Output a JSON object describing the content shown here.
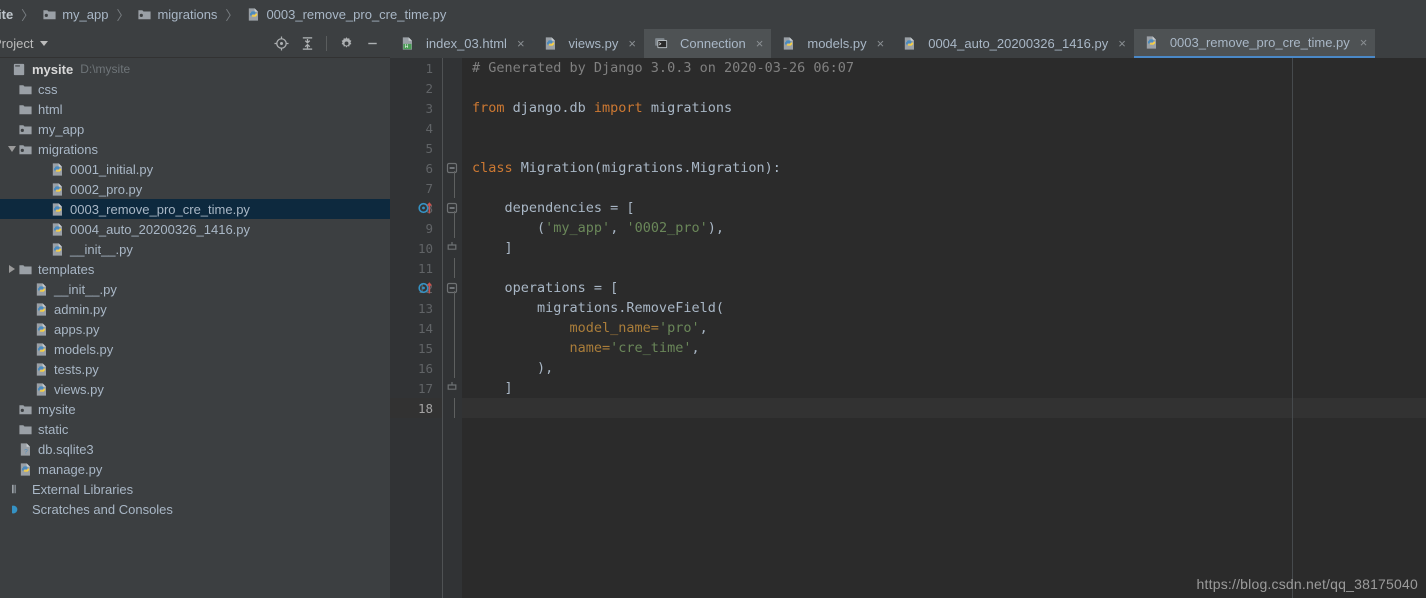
{
  "breadcrumb": {
    "name": "breadcrumb",
    "items": [
      {
        "label": "ite",
        "icon": "none",
        "clipped": true
      },
      {
        "label": "my_app",
        "icon": "module-folder-icon"
      },
      {
        "label": "migrations",
        "icon": "module-folder-icon"
      },
      {
        "label": "0003_remove_pro_cre_time.py",
        "icon": "python-file-icon"
      }
    ],
    "separator": "〉"
  },
  "project_panel": {
    "title": "Project",
    "tools": [
      {
        "name": "locate-target-icon",
        "label": "Select Opened File"
      },
      {
        "name": "collapse-all-icon",
        "label": "Collapse All"
      },
      {
        "name": "gear-icon",
        "label": "Settings"
      },
      {
        "name": "minimize-icon",
        "label": "Hide"
      }
    ],
    "tree": [
      {
        "label": "mysite",
        "sublabel": "D:\\mysite",
        "icon": "project-root-icon",
        "indent": 0,
        "arrow": "none",
        "bold": true,
        "selected": false
      },
      {
        "label": "css",
        "icon": "folder-icon",
        "indent": 1,
        "arrow": "none",
        "selected": false
      },
      {
        "label": "html",
        "icon": "folder-icon",
        "indent": 1,
        "arrow": "none",
        "selected": false
      },
      {
        "label": "my_app",
        "icon": "module-folder-icon",
        "indent": 1,
        "arrow": "none",
        "selected": false
      },
      {
        "label": "migrations",
        "icon": "module-folder-icon",
        "indent": 1,
        "arrow": "down",
        "selected": false
      },
      {
        "label": "0001_initial.py",
        "icon": "python-file-icon",
        "indent": 3,
        "arrow": "none",
        "selected": false
      },
      {
        "label": "0002_pro.py",
        "icon": "python-file-icon",
        "indent": 3,
        "arrow": "none",
        "selected": false
      },
      {
        "label": "0003_remove_pro_cre_time.py",
        "icon": "python-file-icon",
        "indent": 3,
        "arrow": "none",
        "selected": true
      },
      {
        "label": "0004_auto_20200326_1416.py",
        "icon": "python-file-icon",
        "indent": 3,
        "arrow": "none",
        "selected": false
      },
      {
        "label": "__init__.py",
        "icon": "python-file-icon",
        "indent": 3,
        "arrow": "none",
        "selected": false
      },
      {
        "label": "templates",
        "icon": "folder-icon",
        "indent": 1,
        "arrow": "right",
        "selected": false
      },
      {
        "label": "__init__.py",
        "icon": "python-file-icon",
        "indent": 2,
        "arrow": "none",
        "selected": false
      },
      {
        "label": "admin.py",
        "icon": "python-file-icon",
        "indent": 2,
        "arrow": "none",
        "selected": false
      },
      {
        "label": "apps.py",
        "icon": "python-file-icon",
        "indent": 2,
        "arrow": "none",
        "selected": false
      },
      {
        "label": "models.py",
        "icon": "python-file-icon",
        "indent": 2,
        "arrow": "none",
        "selected": false
      },
      {
        "label": "tests.py",
        "icon": "python-file-icon",
        "indent": 2,
        "arrow": "none",
        "selected": false
      },
      {
        "label": "views.py",
        "icon": "python-file-icon",
        "indent": 2,
        "arrow": "none",
        "selected": false
      },
      {
        "label": "mysite",
        "icon": "module-folder-icon",
        "indent": 1,
        "arrow": "none",
        "selected": false
      },
      {
        "label": "static",
        "icon": "folder-icon",
        "indent": 1,
        "arrow": "none",
        "selected": false
      },
      {
        "label": "db.sqlite3",
        "icon": "sqlite-file-icon",
        "indent": 1,
        "arrow": "none",
        "selected": false
      },
      {
        "label": "manage.py",
        "icon": "python-file-icon",
        "indent": 1,
        "arrow": "none",
        "selected": false
      },
      {
        "label": "External Libraries",
        "icon": "external-libraries-icon",
        "indent": 0,
        "arrow": "none",
        "selected": false
      },
      {
        "label": "Scratches and Consoles",
        "icon": "scratches-icon",
        "indent": 0,
        "arrow": "none",
        "selected": false
      }
    ]
  },
  "editor_tabs": [
    {
      "label": "index_03.html",
      "icon": "html-file-icon",
      "state": "normal",
      "close": "×"
    },
    {
      "label": "views.py",
      "icon": "python-file-icon",
      "state": "normal",
      "close": "×"
    },
    {
      "label": "Connection",
      "icon": "console-icon",
      "state": "hover",
      "close": "×"
    },
    {
      "label": "models.py",
      "icon": "python-file-icon",
      "state": "normal",
      "close": "×"
    },
    {
      "label": "0004_auto_20200326_1416.py",
      "icon": "python-file-icon",
      "state": "normal",
      "close": "×"
    },
    {
      "label": "0003_remove_pro_cre_time.py",
      "icon": "python-file-icon",
      "state": "active",
      "close": "×"
    }
  ],
  "editor": {
    "current_line": 18,
    "line_count": 18,
    "lines": [
      {
        "n": 1,
        "marker": "none",
        "fold": "none",
        "tokens": [
          {
            "t": "# Generated by Django 3.0.3 on 2020-03-26 06:07",
            "c": "tk-cmt"
          }
        ]
      },
      {
        "n": 2,
        "marker": "none",
        "fold": "none",
        "tokens": []
      },
      {
        "n": 3,
        "marker": "none",
        "fold": "none",
        "tokens": [
          {
            "t": "from",
            "c": "tk-kw"
          },
          {
            "t": " django.db ",
            "c": "tk-par"
          },
          {
            "t": "import",
            "c": "tk-kw"
          },
          {
            "t": " migrations",
            "c": "tk-par"
          }
        ]
      },
      {
        "n": 4,
        "marker": "none",
        "fold": "none",
        "tokens": []
      },
      {
        "n": 5,
        "marker": "none",
        "fold": "none",
        "tokens": []
      },
      {
        "n": 6,
        "marker": "none",
        "fold": "collapse",
        "tokens": [
          {
            "t": "class",
            "c": "tk-kw"
          },
          {
            "t": " Migration(migrations.Migration):",
            "c": "tk-cls"
          }
        ]
      },
      {
        "n": 7,
        "marker": "none",
        "fold": "bar",
        "tokens": []
      },
      {
        "n": 8,
        "marker": "override",
        "fold": "collapse",
        "tokens": [
          {
            "t": "    dependencies = [",
            "c": "tk-par"
          }
        ]
      },
      {
        "n": 9,
        "marker": "none",
        "fold": "bar",
        "tokens": [
          {
            "t": "        (",
            "c": "tk-par"
          },
          {
            "t": "'my_app'",
            "c": "tk-str"
          },
          {
            "t": ", ",
            "c": "tk-par"
          },
          {
            "t": "'0002_pro'",
            "c": "tk-str"
          },
          {
            "t": "),",
            "c": "tk-par"
          }
        ]
      },
      {
        "n": 10,
        "marker": "none",
        "fold": "end",
        "tokens": [
          {
            "t": "    ]",
            "c": "tk-par"
          }
        ]
      },
      {
        "n": 11,
        "marker": "none",
        "fold": "bar",
        "tokens": []
      },
      {
        "n": 12,
        "marker": "override",
        "fold": "collapse",
        "tokens": [
          {
            "t": "    operations = [",
            "c": "tk-par"
          }
        ]
      },
      {
        "n": 13,
        "marker": "none",
        "fold": "bar",
        "tokens": [
          {
            "t": "        migrations.RemoveField(",
            "c": "tk-par"
          }
        ]
      },
      {
        "n": 14,
        "marker": "none",
        "fold": "bar",
        "tokens": [
          {
            "t": "            model_name=",
            "c": "tk-arg"
          },
          {
            "t": "'pro'",
            "c": "tk-str"
          },
          {
            "t": ",",
            "c": "tk-par"
          }
        ]
      },
      {
        "n": 15,
        "marker": "none",
        "fold": "bar",
        "tokens": [
          {
            "t": "            name=",
            "c": "tk-arg"
          },
          {
            "t": "'cre_time'",
            "c": "tk-str"
          },
          {
            "t": ",",
            "c": "tk-par"
          }
        ]
      },
      {
        "n": 16,
        "marker": "none",
        "fold": "bar",
        "tokens": [
          {
            "t": "        ),",
            "c": "tk-par"
          }
        ]
      },
      {
        "n": 17,
        "marker": "none",
        "fold": "end",
        "tokens": [
          {
            "t": "    ]",
            "c": "tk-par"
          }
        ]
      },
      {
        "n": 18,
        "marker": "none",
        "fold": "bar",
        "tokens": []
      }
    ]
  },
  "watermark": "https://blog.csdn.net/qq_38175040",
  "colors": {
    "panel_bg": "#3c3f41",
    "editor_bg": "#2b2b2b",
    "gutter_bg": "#313335",
    "selection_bg": "#0d293e",
    "tab_active_bg": "#4e5254",
    "tab_underline": "#4a88c7",
    "text": "#a9b7c6",
    "comment": "#808080",
    "keyword": "#cc7832",
    "string": "#6a8759",
    "number": "#6897bb",
    "kwarg": "#aa7d3a",
    "current_line": "#323232"
  }
}
